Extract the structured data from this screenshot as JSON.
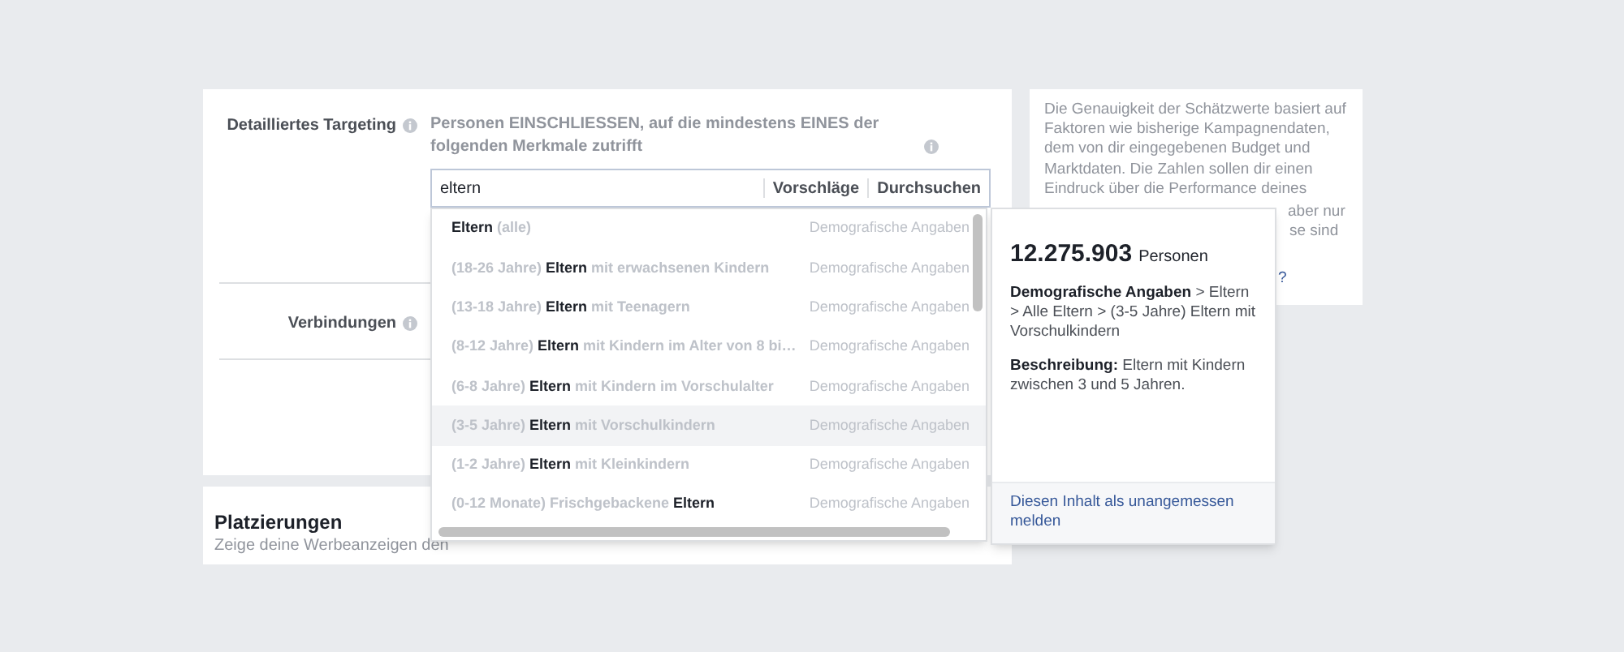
{
  "targeting": {
    "label": "Detailliertes Targeting",
    "description": "Personen EINSCHLIESSEN, auf die mindestens EINES der folgenden Merkmale zutrifft",
    "search": {
      "value": "eltern",
      "links": [
        "Vorschläge",
        "Durchsuchen"
      ]
    }
  },
  "connections": {
    "label": "Verbindungen"
  },
  "placements": {
    "title": "Platzierungen",
    "subtitle": "Zeige deine Werbeanzeigen den"
  },
  "estimate_note": {
    "text": "Die Genauigkeit der Schätzwerte basiert auf Faktoren wie bisherige Kampagnendaten, dem von dir eingegebenen Budget und Marktdaten. Die Zahlen sollen dir einen Eindruck über die Performance deines",
    "fragments": [
      "aber nur",
      "se sind"
    ],
    "link": "?"
  },
  "suggestions": [
    {
      "text": "**Eltern** (alle)",
      "category": "Demografische Angaben",
      "selected": false
    },
    {
      "text": "(18-26 Jahre) **Eltern** mit erwachsenen Kindern",
      "category": "Demografische Angaben",
      "selected": false
    },
    {
      "text": "(13-18 Jahre) **Eltern** mit Teenagern",
      "category": "Demografische Angaben",
      "selected": false
    },
    {
      "text": "(8-12 Jahre) **Eltern** mit Kindern im Alter von 8 bi…",
      "category": "Demografische Angaben",
      "selected": false
    },
    {
      "text": "(6-8 Jahre) **Eltern** mit Kindern im Vorschulalter",
      "category": "Demografische Angaben",
      "selected": false
    },
    {
      "text": "(3-5 Jahre) **Eltern** mit Vorschulkindern",
      "category": "Demografische Angaben",
      "selected": true
    },
    {
      "text": "(1-2 Jahre) **Eltern** mit Kleinkindern",
      "category": "Demografische Angaben",
      "selected": false
    },
    {
      "text": "(0-12 Monate) Frischgebackene **Eltern**",
      "category": "Demografische Angaben",
      "selected": false
    }
  ],
  "detail": {
    "count": "12.275.903",
    "count_unit": "Personen",
    "path": "**Demografische Angaben** > Eltern > Alle Eltern > (3-5 Jahre) Eltern mit Vorschulkindern",
    "description": "**Beschreibung:** Eltern mit Kindern zwischen 3 und 5 Jahren.",
    "report_link": "Diesen Inhalt als unangemessen melden"
  }
}
